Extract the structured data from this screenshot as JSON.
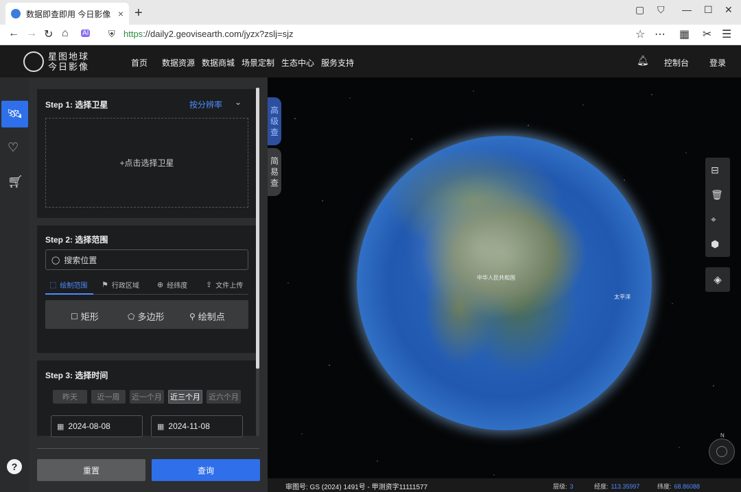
{
  "browser": {
    "tab_title": "数据即查即用 今日影像",
    "url_https": "https",
    "url_rest": "://daily2.geovisearth.com/jyzx?zslj=sjz",
    "new_tab": "+",
    "tab_close": "×"
  },
  "header": {
    "logo_line1": "星图地球",
    "logo_line2": "今日影像",
    "nav": [
      "首页",
      "数据资源",
      "数据商城",
      "场景定制",
      "生态中心",
      "服务支持"
    ],
    "console": "控制台",
    "login": "登录"
  },
  "step1": {
    "title": "Step 1: 选择卫星",
    "by_resolution": "按分辨率",
    "chevron": "⌄",
    "select_satellite": "+点击选择卫星"
  },
  "step2": {
    "title": "Step 2: 选择范围",
    "search_placeholder": "搜索位置",
    "tabs": [
      "绘制范围",
      "行政区域",
      "经纬度",
      "文件上传"
    ],
    "shapes": [
      "矩形",
      "多边形",
      "绘制点"
    ]
  },
  "step3": {
    "title": "Step 3: 选择时间",
    "quick": [
      "昨天",
      "近一周",
      "近一个月",
      "近三个月",
      "近六个月"
    ],
    "start_date": "2024-08-08",
    "end_date": "2024-11-08"
  },
  "actions": {
    "reset": "重置",
    "query": "查询"
  },
  "side_tabs": {
    "advanced": [
      "高",
      "级",
      "查"
    ],
    "simple": [
      "简",
      "易",
      "查"
    ]
  },
  "map": {
    "labels": {
      "china": "中华人民共和国",
      "pacific": "太平洋"
    },
    "compass_n": "N",
    "approval": "审图号:  GS (2024) 1491号 - 甲测资字11111577",
    "level_label": "层级:",
    "level_value": "3",
    "lng_label": "经度:",
    "lng_value": "113.35997",
    "lat_label": "纬度:",
    "lat_value": "68.86088"
  },
  "help": "?",
  "colors": {
    "accent": "#2f6fea",
    "link": "#4f8cff",
    "header_bg": "#1a1a1b",
    "panel_bg": "#2d2e30"
  },
  "icons": {
    "sidebar": [
      "satellite-icon",
      "heart-icon",
      "cart-icon"
    ],
    "map_tools": [
      "ruler-icon",
      "trash-icon",
      "locate-icon",
      "cube-icon"
    ],
    "layers": "layers-icon"
  }
}
